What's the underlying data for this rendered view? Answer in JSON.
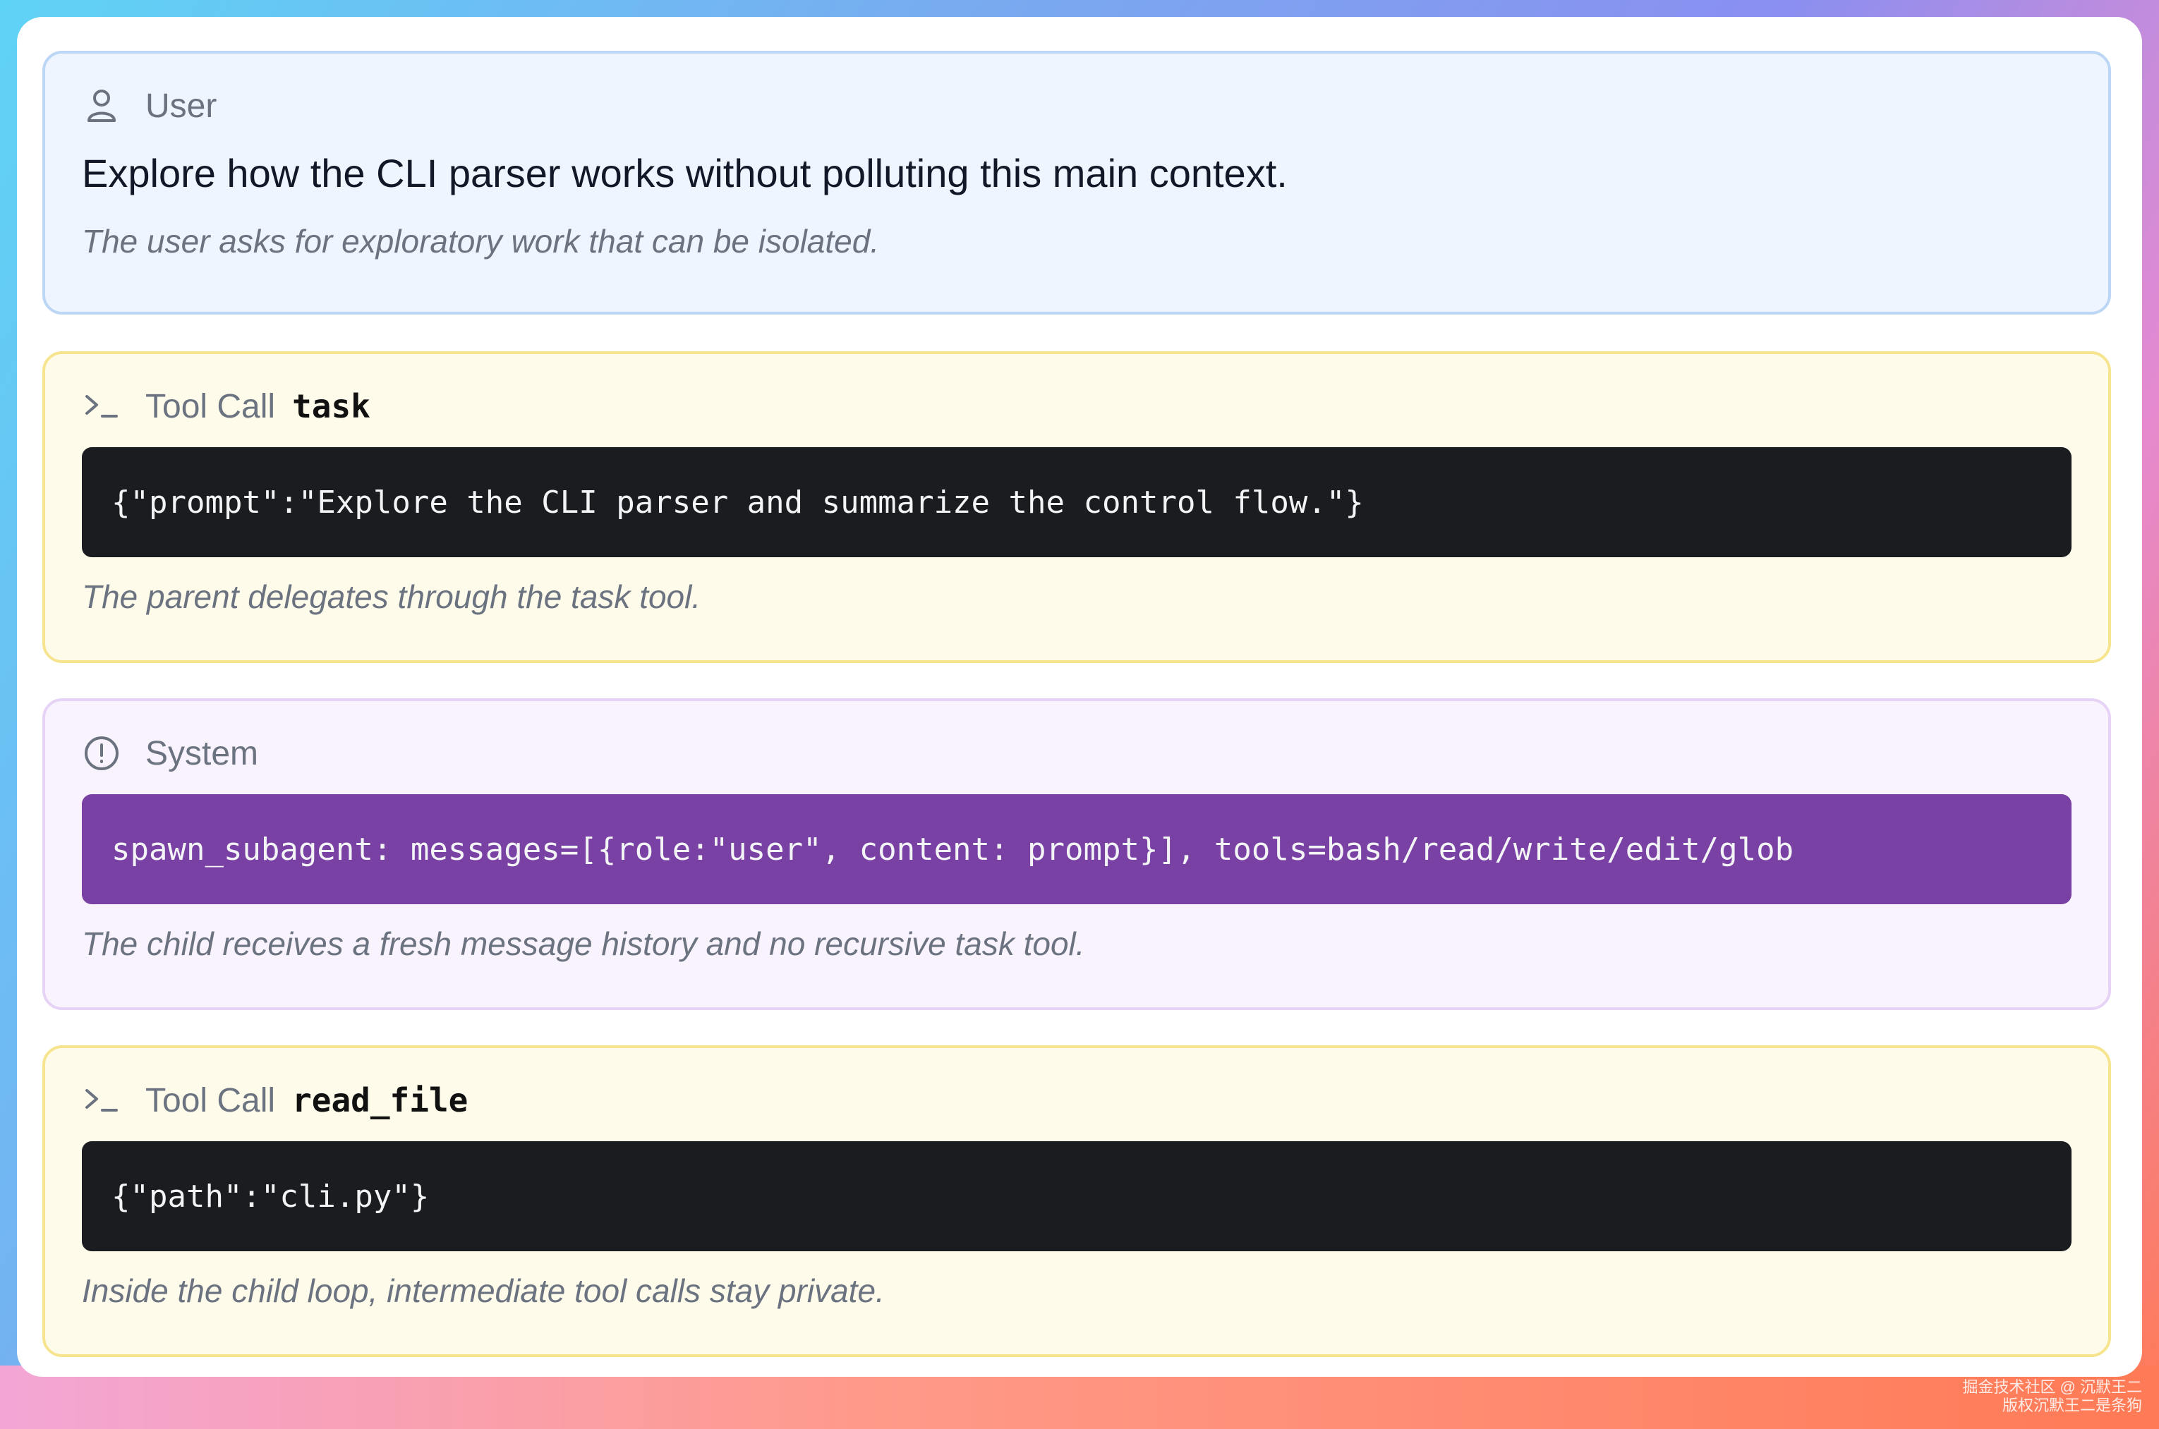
{
  "messages": [
    {
      "role": "User",
      "icon": "user-icon",
      "text": "Explore how the CLI parser works without polluting this main context.",
      "note": "The user asks for exploratory work that can be isolated."
    },
    {
      "role": "Tool Call",
      "icon": "terminal-icon",
      "tool": "task",
      "code": "{\"prompt\":\"Explore the CLI parser and summarize the control flow.\"}",
      "note": "The parent delegates through the task tool."
    },
    {
      "role": "System",
      "icon": "alert-circle-icon",
      "code": "spawn_subagent: messages=[{role:\"user\", content: prompt}], tools=bash/read/write/edit/glob",
      "note": "The child receives a fresh message history and no recursive task tool."
    },
    {
      "role": "Tool Call",
      "icon": "terminal-icon",
      "tool": "read_file",
      "code": "{\"path\":\"cli.py\"}",
      "note": "Inside the child loop, intermediate tool calls stay private."
    }
  ],
  "watermark": {
    "line1": "掘金技术社区 @ 沉默王二",
    "line2": "版权沉默王二是条狗"
  },
  "colors": {
    "user_bg": "#eef5fe",
    "tool_bg": "#fefbea",
    "system_bg": "#f9f3fe",
    "code_dark": "#1b1c20",
    "code_purple": "#7a41a4"
  }
}
